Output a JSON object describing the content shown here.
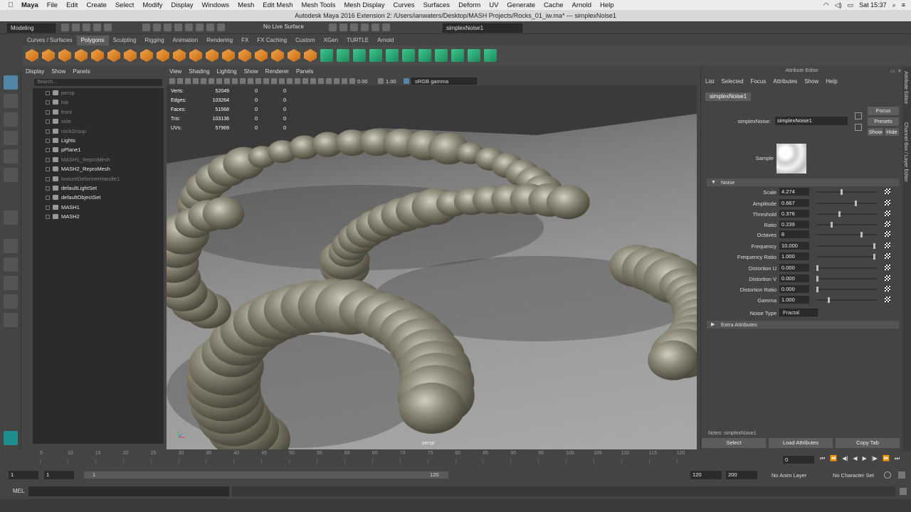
{
  "menubar": {
    "app": "Maya",
    "items": [
      "File",
      "Edit",
      "Create",
      "Select",
      "Modify",
      "Display",
      "Windows",
      "Mesh",
      "Edit Mesh",
      "Mesh Tools",
      "Mesh Display",
      "Curves",
      "Surfaces",
      "Deform",
      "UV",
      "Generate",
      "Cache",
      "Arnold",
      "Help"
    ],
    "clock": "Sat 15:37"
  },
  "titlebar": {
    "title": "Autodesk Maya 2016 Extension 2: /Users/ianwaters/Desktop/MASH Projects/Rocks_01_iw.ma*    ---    simplexNoise1"
  },
  "statusline": {
    "mode": "Modeling",
    "live_surface": "No Live Surface",
    "selection_field": "simplexNoise1"
  },
  "shelf": {
    "tabs": [
      "Curves / Surfaces",
      "Polygons",
      "Sculpting",
      "Rigging",
      "Animation",
      "Rendering",
      "FX",
      "FX Caching",
      "Custom",
      "XGen",
      "TURTLE",
      "Arnold"
    ],
    "active_tab": "Polygons"
  },
  "outliner": {
    "menu": [
      "Display",
      "Show",
      "Panels"
    ],
    "search_placeholder": "Search...",
    "items": [
      {
        "label": "persp",
        "dim": true
      },
      {
        "label": "top",
        "dim": true
      },
      {
        "label": "front",
        "dim": true
      },
      {
        "label": "side",
        "dim": true
      },
      {
        "label": "rockGroup",
        "dim": true
      },
      {
        "label": "Lights",
        "dim": false
      },
      {
        "label": "pPlane1",
        "dim": false
      },
      {
        "label": "MASH1_ReproMesh",
        "dim": true
      },
      {
        "label": "MASH2_ReproMesh",
        "dim": false
      },
      {
        "label": "textureDeformerHandle1",
        "dim": true
      },
      {
        "label": "defaultLightSet",
        "dim": false
      },
      {
        "label": "defaultObjectSet",
        "dim": false
      },
      {
        "label": "MASH1",
        "dim": false
      },
      {
        "label": "MASH2",
        "dim": false
      }
    ]
  },
  "viewport": {
    "menu": [
      "View",
      "Shading",
      "Lighting",
      "Show",
      "Renderer",
      "Panels"
    ],
    "exposure": "0.00",
    "gamma": "1.00",
    "color_space": "sRGB gamma",
    "camera": "persp",
    "hud": [
      {
        "label": "Verts:",
        "v1": "52049",
        "v2": "0",
        "v3": "0"
      },
      {
        "label": "Edges:",
        "v1": "103264",
        "v2": "0",
        "v3": "0"
      },
      {
        "label": "Faces:",
        "v1": "51568",
        "v2": "0",
        "v3": "0"
      },
      {
        "label": "Tris:",
        "v1": "103136",
        "v2": "0",
        "v3": "0"
      },
      {
        "label": "UVs:",
        "v1": "57969",
        "v2": "0",
        "v3": "0"
      }
    ]
  },
  "attr": {
    "title": "Attribute Editor",
    "menu": [
      "List",
      "Selected",
      "Focus",
      "Attributes",
      "Show",
      "Help"
    ],
    "node_tab": "simplexNoise1",
    "node_label": "simplexNoise:",
    "node_value": "simplexNoise1",
    "focus": "Focus",
    "presets": "Presets",
    "show": "Show",
    "hide": "Hide",
    "sample_label": "Sample",
    "section_noise": "Noise",
    "section_extra": "Extra Attributes",
    "noise_type_label": "Noise Type",
    "noise_type_value": "Fractal",
    "notes": "Notes:  simplexNoise1",
    "rows": [
      {
        "label": "Scale",
        "value": "4.274",
        "slider": 0.42
      },
      {
        "label": "Amplitude",
        "value": "0.667",
        "slider": 0.66
      },
      {
        "label": "Threshold",
        "value": "0.376",
        "slider": 0.38
      },
      {
        "label": "Ratio",
        "value": "0.239",
        "slider": 0.24
      },
      {
        "label": "Octaves",
        "value": "8",
        "slider": 0.76
      },
      {
        "label": "Frequency",
        "value": "10.000",
        "slider": 0.97
      },
      {
        "label": "Frequency Ratio",
        "value": "1.000",
        "slider": 0.97
      },
      {
        "label": "Distortion U",
        "value": "0.000",
        "slider": 0.0
      },
      {
        "label": "Distortion V",
        "value": "0.000",
        "slider": 0.0
      },
      {
        "label": "Distortion Ratio",
        "value": "0.000",
        "slider": 0.0
      },
      {
        "label": "Gamma",
        "value": "1.000",
        "slider": 0.2
      }
    ],
    "buttons": {
      "select": "Select",
      "load": "Load Attributes",
      "copy": "Copy Tab"
    }
  },
  "sidetabs": [
    "Attribute Editor",
    "Channel Box / Layer Editor"
  ],
  "timeline": {
    "ticks": [
      "5",
      "10",
      "15",
      "20",
      "25",
      "30",
      "35",
      "40",
      "45",
      "50",
      "55",
      "60",
      "65",
      "70",
      "75",
      "80",
      "85",
      "90",
      "95",
      "100",
      "105",
      "110",
      "115",
      "120"
    ],
    "current": "0"
  },
  "range": {
    "start": "1",
    "start2": "1",
    "slider_start": "1",
    "slider_end": "120",
    "end": "120",
    "end2": "200",
    "anim_layer": "No Anim Layer",
    "char_set": "No Character Set"
  },
  "cmdline": {
    "label": "MEL"
  }
}
